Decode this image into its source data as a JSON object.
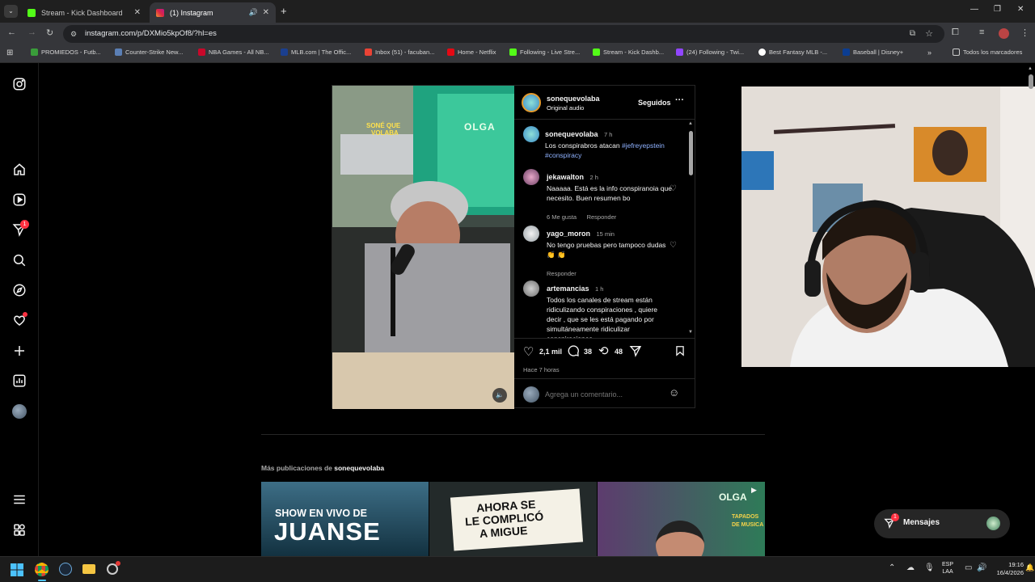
{
  "browser": {
    "tabs": [
      {
        "title": "Stream - Kick Dashboard",
        "favicon_color": "#53fc18",
        "active": false
      },
      {
        "title": "(1) Instagram",
        "favicon_color": "#e1306c",
        "active": true
      }
    ],
    "url": "instagram.com/p/DXMio5kpOf8/?hl=es",
    "bookmarks": [
      {
        "label": "PROMIEDOS - Futb...",
        "color": "#3a9d3a"
      },
      {
        "label": "Counter-Strike New...",
        "color": "#5b7fb5"
      },
      {
        "label": "NBA Games - All NB...",
        "color": "#c9082a"
      },
      {
        "label": "MLB.com | The Offic...",
        "color": "#1b3f8f"
      },
      {
        "label": "Inbox (51) - facuban...",
        "color": "#ea4335"
      },
      {
        "label": "Home - Netflix",
        "color": "#e50914"
      },
      {
        "label": "Following - Live Stre...",
        "color": "#53fc18"
      },
      {
        "label": "Stream - Kick Dashb...",
        "color": "#53fc18"
      },
      {
        "label": "(24) Following - Twi...",
        "color": "#9146ff"
      },
      {
        "label": "Best Fantasy MLB -...",
        "color": "#ffffff"
      },
      {
        "label": "Baseball | Disney+",
        "color": "#0b3d91"
      }
    ],
    "all_bookmarks_label": "Todos los marcadores"
  },
  "sidebar": {
    "items": [
      {
        "icon": "instagram-logo-icon"
      },
      {
        "icon": "home-icon"
      },
      {
        "icon": "reels-icon"
      },
      {
        "icon": "direct-messages-icon",
        "badge": "1"
      },
      {
        "icon": "search-icon"
      },
      {
        "icon": "explore-icon"
      },
      {
        "icon": "notifications-heart-icon"
      },
      {
        "icon": "create-icon"
      },
      {
        "icon": "dashboard-icon"
      },
      {
        "icon": "profile-avatar-icon"
      },
      {
        "icon": "more-menu-icon"
      },
      {
        "icon": "also-from-meta-icon"
      }
    ]
  },
  "post": {
    "author": "sonequevolaba",
    "audio": "Original audio",
    "follow_state": "Seguidos",
    "video_overlay_text": "OLGA",
    "caption": {
      "user": "sonequevolaba",
      "time": "7 h",
      "text": "Los conspirabros atacan ",
      "hashtags": [
        "#jefreyepstein",
        "#conspiracy"
      ]
    },
    "comments": [
      {
        "user": "jekawalton",
        "time": "2 h",
        "text": "Naaaaa. Está es la info conspiranoia que necesito. Buen resumen bo",
        "likes": "6 Me gusta",
        "reply": "Responder"
      },
      {
        "user": "yago_moron",
        "time": "15 min",
        "text": "No tengo pruebas pero tampoco dudas 👏 👏",
        "reply": "Responder"
      },
      {
        "user": "artemancias",
        "time": "1 h",
        "text": "Todos los canales de stream están ridiculizando conspiraciones , quiere decir , que se les está pagando por simultáneamente ridiculizar conspiraciones ,"
      }
    ],
    "actions": {
      "likes": "2,1 mil",
      "comments": "38",
      "reposts": "48"
    },
    "timestamp": "Hace 7 horas",
    "comment_placeholder": "Agrega un comentario..."
  },
  "more_posts": {
    "label_prefix": "Más publicaciones de ",
    "username": "sonequevolaba",
    "thumbnails": [
      {
        "line1": "SHOW EN VIVO DE",
        "line2": "JUANSE"
      },
      {
        "line1": "AHORA SE",
        "line2": "LE COMPLICÓ",
        "line3": "A MIGUE"
      },
      {
        "line1": "OLGA",
        "line2": "TAPADOS",
        "line3": "DE MUSICA"
      }
    ]
  },
  "messages_pill": {
    "label": "Mensajes",
    "badge": "1"
  },
  "taskbar": {
    "lang1": "ESP",
    "lang2": "LAA",
    "time": "19:16",
    "date": "16/4/2026"
  }
}
